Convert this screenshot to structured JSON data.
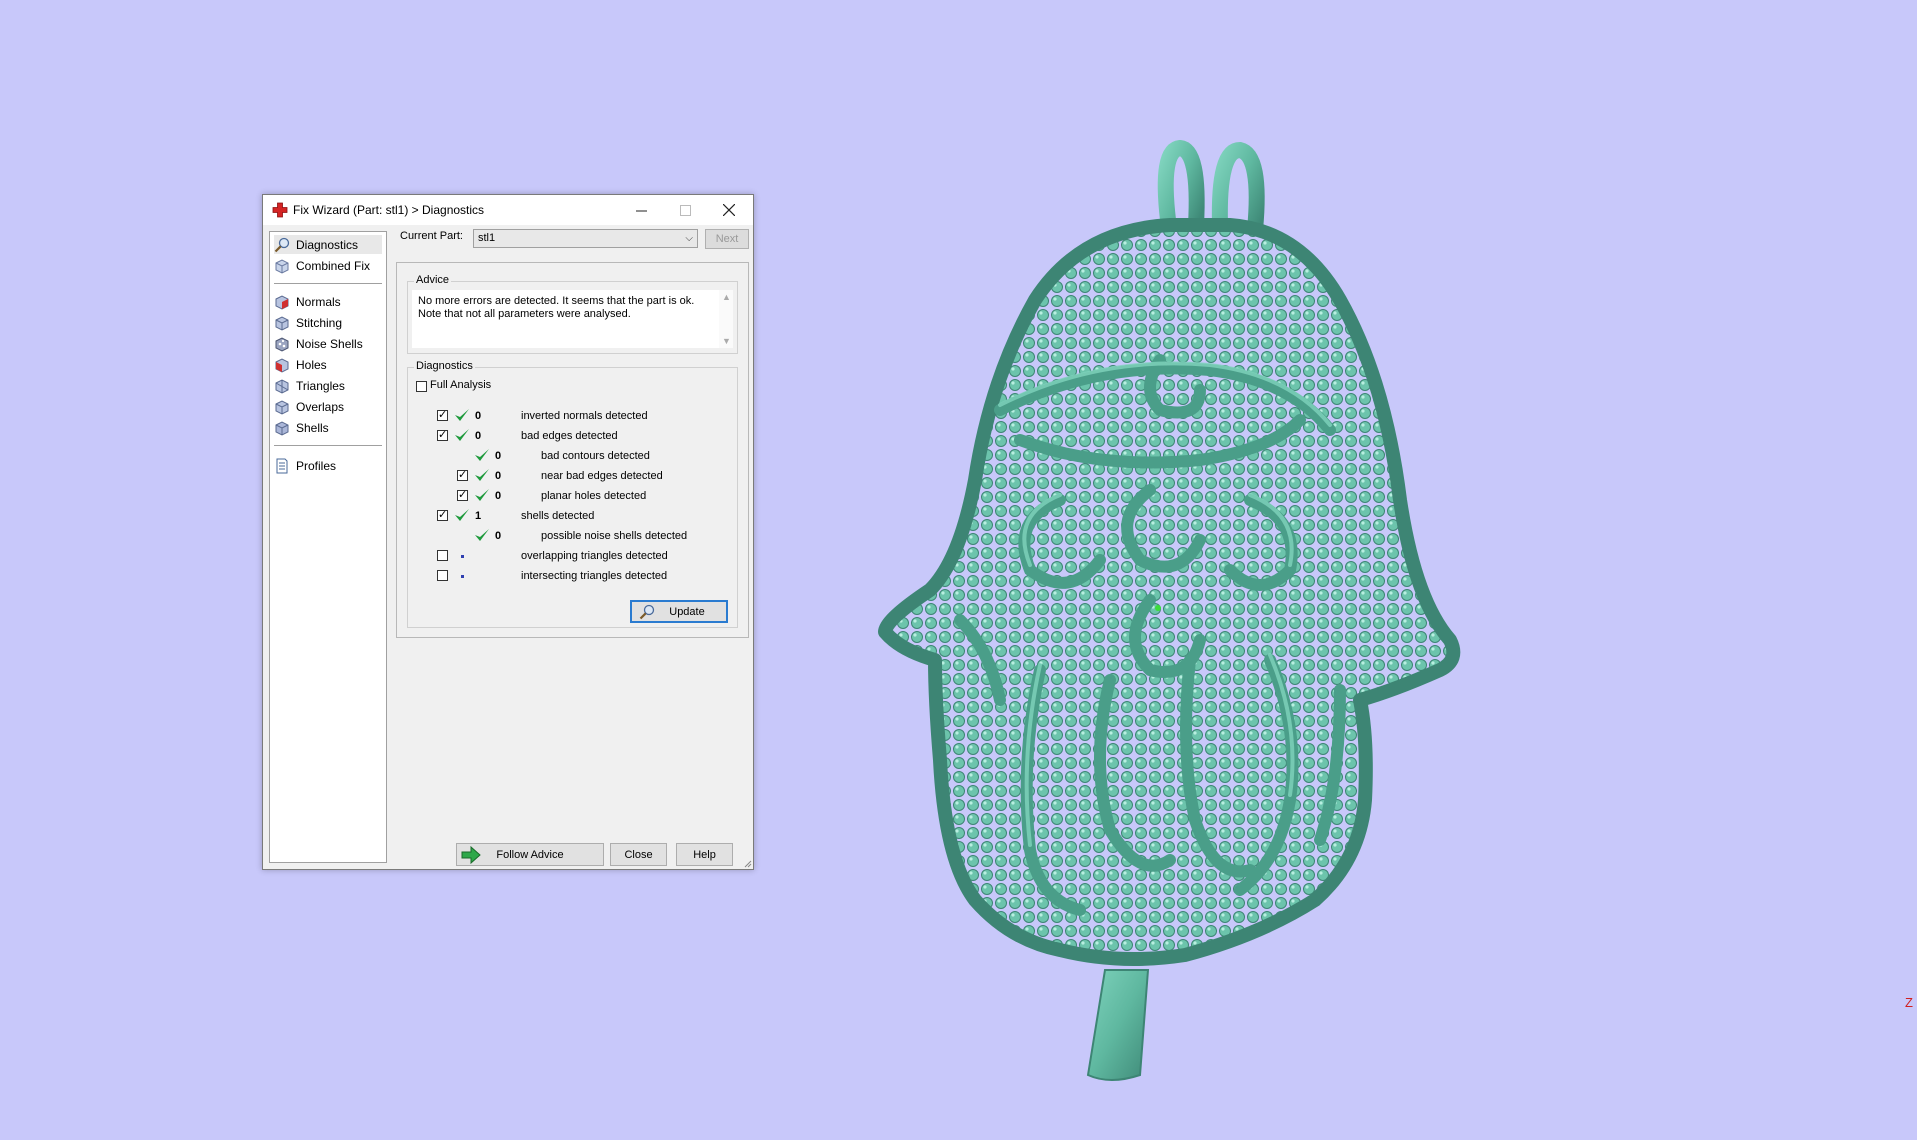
{
  "viewport": {
    "background": "#c8c8fa",
    "model_color": "#5fb8a0",
    "axis_label": "Z"
  },
  "dialog": {
    "title": "Fix Wizard (Part: stl1) > Diagnostics",
    "nav": {
      "top_items": [
        {
          "label": "Diagnostics",
          "icon": "magnifier-icon"
        },
        {
          "label": "Combined Fix",
          "icon": "cube-icon"
        }
      ],
      "tool_items": [
        {
          "label": "Normals",
          "icon": "normals-cube-icon"
        },
        {
          "label": "Stitching",
          "icon": "stitching-cube-icon"
        },
        {
          "label": "Noise Shells",
          "icon": "noise-shells-icon"
        },
        {
          "label": "Holes",
          "icon": "holes-cube-icon"
        },
        {
          "label": "Triangles",
          "icon": "triangles-cube-icon"
        },
        {
          "label": "Overlaps",
          "icon": "overlaps-cube-icon"
        },
        {
          "label": "Shells",
          "icon": "shells-cube-icon"
        }
      ],
      "bottom_items": [
        {
          "label": "Profiles",
          "icon": "document-icon"
        }
      ]
    },
    "current_part_label": "Current Part:",
    "current_part_value": "stl1",
    "next_label": "Next",
    "advice": {
      "title": "Advice",
      "text": "No more errors are detected. It seems that the part is ok.\nNote that not all parameters were analysed."
    },
    "diagnostics": {
      "title": "Diagnostics",
      "full_analysis_label": "Full Analysis",
      "full_analysis_checked": false,
      "rows": [
        {
          "label": "inverted normals detected",
          "count": "0",
          "checked": true,
          "status": "ok",
          "indent": 0
        },
        {
          "label": "bad edges detected",
          "count": "0",
          "checked": true,
          "status": "ok",
          "indent": 0
        },
        {
          "label": "bad contours detected",
          "count": "0",
          "checked": null,
          "status": "ok",
          "indent": 1
        },
        {
          "label": "near bad edges detected",
          "count": "0",
          "checked": true,
          "status": "ok",
          "indent": 1
        },
        {
          "label": "planar holes detected",
          "count": "0",
          "checked": true,
          "status": "ok",
          "indent": 1
        },
        {
          "label": "shells detected",
          "count": "1",
          "checked": true,
          "status": "ok",
          "indent": 0
        },
        {
          "label": "possible noise shells detected",
          "count": "0",
          "checked": null,
          "status": "ok",
          "indent": 1
        },
        {
          "label": "overlapping triangles detected",
          "count": "",
          "checked": false,
          "status": "none",
          "indent": 0
        },
        {
          "label": "intersecting triangles detected",
          "count": "",
          "checked": false,
          "status": "none",
          "indent": 0
        }
      ],
      "update_label": "Update"
    },
    "buttons": {
      "follow_advice": "Follow Advice",
      "close": "Close",
      "help": "Help"
    }
  }
}
